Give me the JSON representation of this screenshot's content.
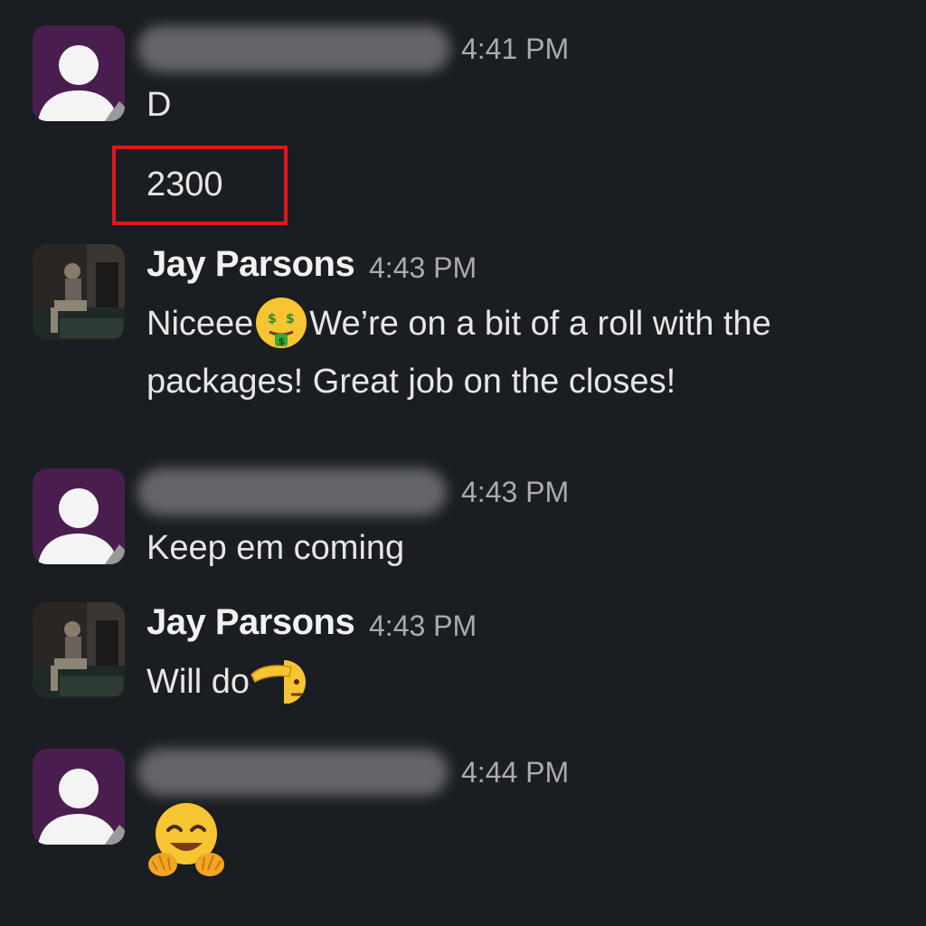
{
  "messages": [
    {
      "sender": "",
      "sender_visible": false,
      "avatar": "default-user-avatar",
      "time": "4:41 PM",
      "lines": [
        "D",
        "2300"
      ]
    },
    {
      "sender": "Jay Parsons",
      "avatar": "photo-avatar",
      "time": "4:43 PM",
      "line1_a": "Niceee",
      "line1_emoji": "money-mouth-face-icon",
      "line1_b": "We’re on a bit of a roll with the",
      "line2": "packages! Great job on the closes!"
    },
    {
      "sender": "",
      "sender_visible": false,
      "avatar": "default-user-avatar",
      "time": "4:43 PM",
      "text": "Keep em coming"
    },
    {
      "sender": "Jay Parsons",
      "avatar": "photo-avatar",
      "time": "4:43 PM",
      "text": "Will do",
      "emoji": "saluting-face-icon"
    },
    {
      "sender": "",
      "sender_visible": false,
      "avatar": "default-user-avatar",
      "time": "4:44 PM",
      "emoji": "hugging-face-icon"
    }
  ],
  "colors": {
    "background": "#1a1d21",
    "avatar_purple": "#4a1d4f",
    "highlight": "#e0161b",
    "timestamp": "#a9abad"
  }
}
